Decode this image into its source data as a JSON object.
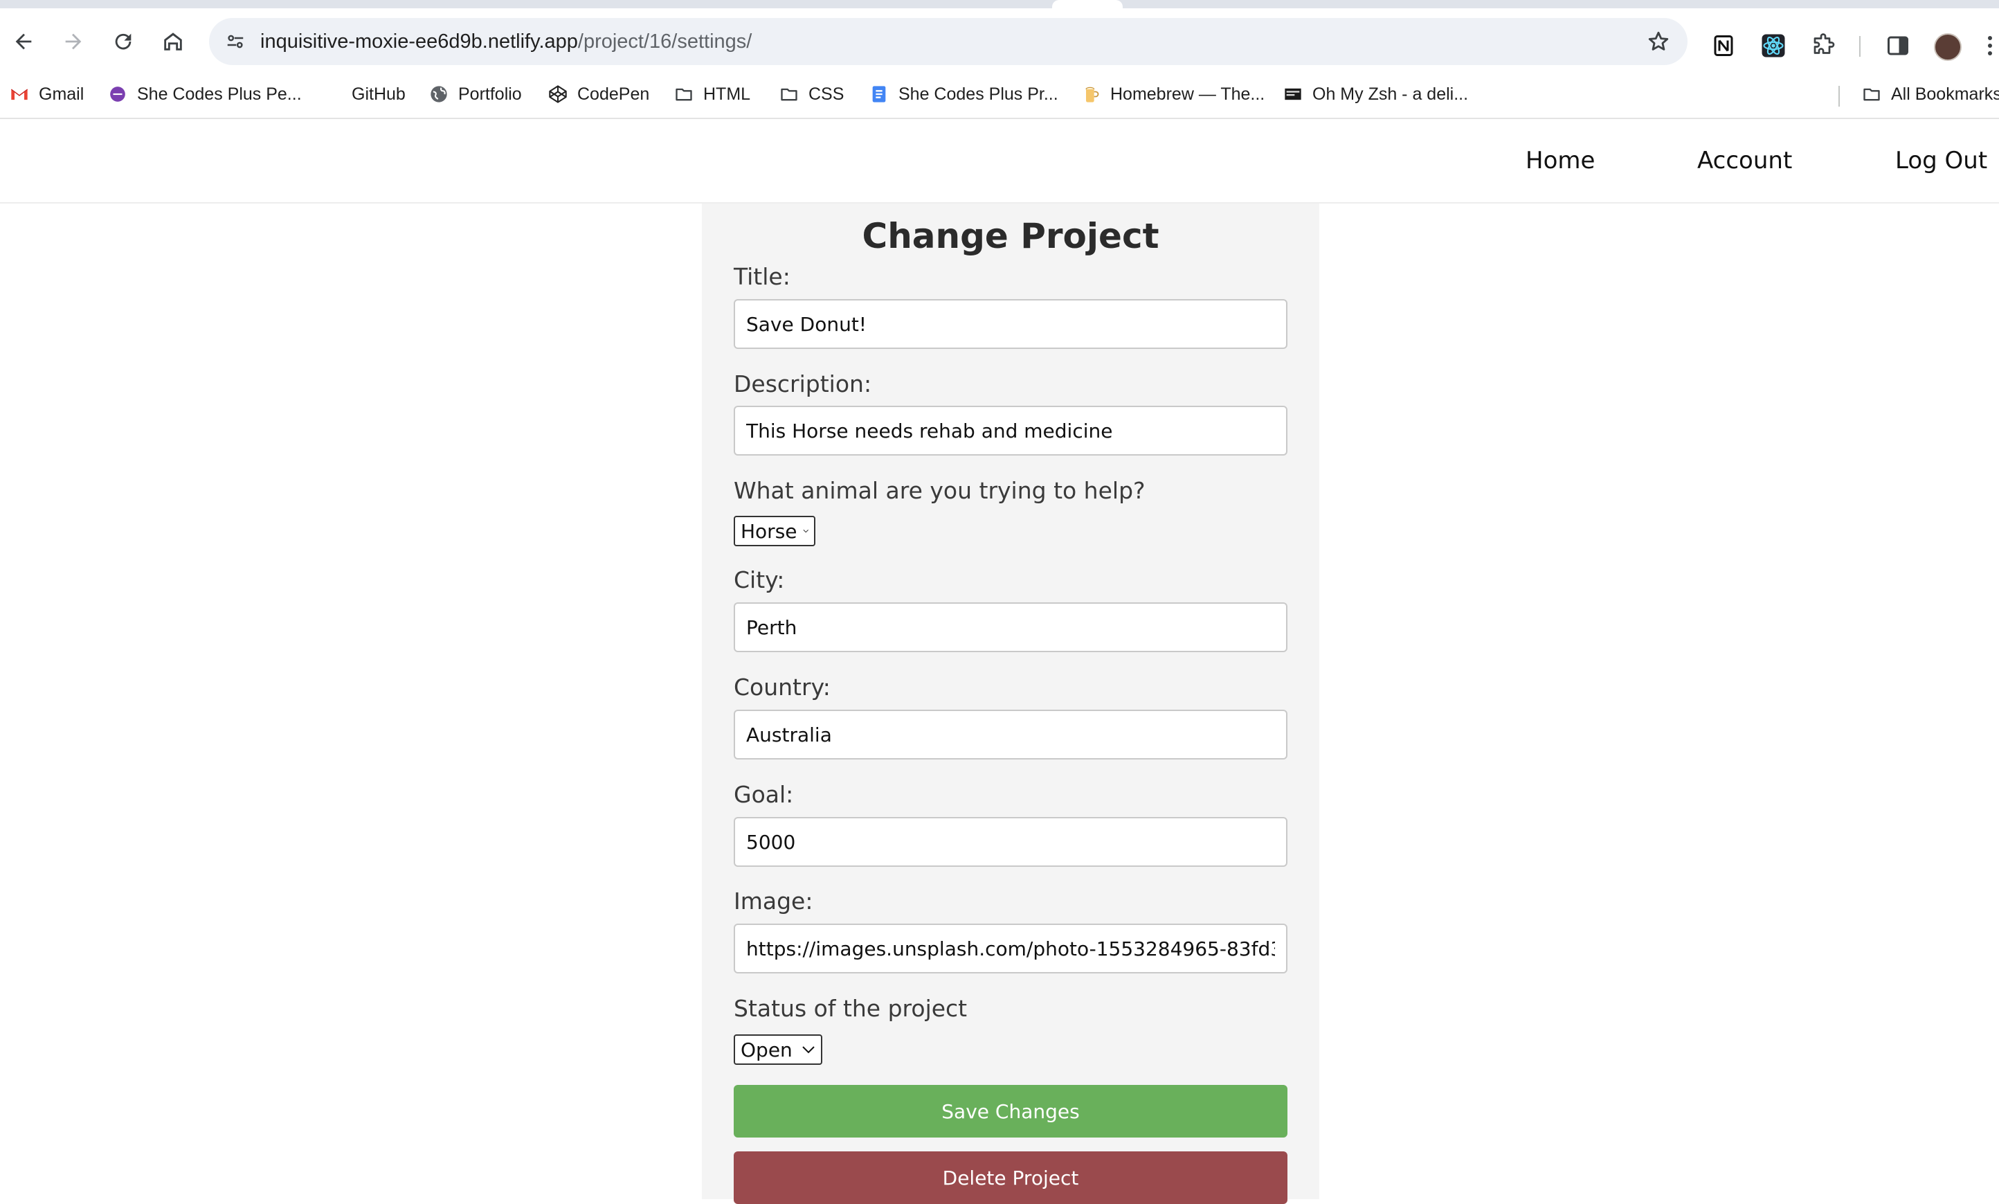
{
  "browser": {
    "url_host": "inquisitive-moxie-ee6d9b.netlify.app",
    "url_path": "/project/16/settings/",
    "bookmarks": [
      {
        "label": "Gmail",
        "icon": "gmail-icon"
      },
      {
        "label": "She Codes Plus Pe...",
        "icon": "she-codes-icon"
      },
      {
        "label": "GitHub",
        "icon": "github-icon"
      },
      {
        "label": "Portfolio",
        "icon": "globe-icon"
      },
      {
        "label": "CodePen",
        "icon": "codepen-icon"
      },
      {
        "label": "HTML",
        "icon": "folder-icon"
      },
      {
        "label": "CSS",
        "icon": "folder-icon"
      },
      {
        "label": "She Codes Plus Pr...",
        "icon": "doc-icon"
      },
      {
        "label": "Homebrew — The...",
        "icon": "homebrew-icon"
      },
      {
        "label": "Oh My Zsh - a deli...",
        "icon": "terminal-icon"
      }
    ],
    "all_bookmarks": "All Bookmarks"
  },
  "nav": {
    "home": "Home",
    "account": "Account",
    "logout": "Log Out"
  },
  "form": {
    "heading": "Change Project",
    "title_label": "Title:",
    "title_value": "Save Donut!",
    "description_label": "Description:",
    "description_value": "This Horse needs rehab and medicine",
    "animal_label": "What animal are you trying to help?",
    "animal_value": "Horse",
    "city_label": "City:",
    "city_value": "Perth",
    "country_label": "Country:",
    "country_value": "Australia",
    "goal_label": "Goal:",
    "goal_value": "5000",
    "image_label": "Image:",
    "image_value": "https://images.unsplash.com/photo-1553284965-83fd3e82fa5a",
    "status_label": "Status of the project",
    "status_value": "Open",
    "save_label": "Save Changes",
    "delete_label": "Delete Project"
  },
  "colors": {
    "save": "#69b05b",
    "delete": "#9a4a4d",
    "card_bg": "#f4f4f4"
  }
}
